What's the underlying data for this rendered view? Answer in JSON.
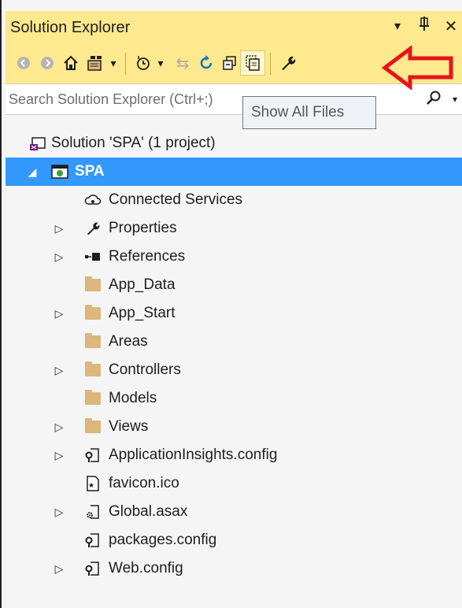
{
  "window": {
    "title": "Solution Explorer",
    "dropdown_glyph": "▾",
    "pin_glyph": "⊥",
    "close_glyph": "✕"
  },
  "toolbar": {
    "back_glyph": "◀",
    "forward_glyph": "▶",
    "home_glyph": "⌂",
    "switch_views_glyph": "⊞",
    "dropdown_glyph": "▾",
    "pending_changes_glyph": "◷",
    "sync_glyph": "⇆",
    "refresh_glyph": "↻",
    "collapse_all_glyph": "⊟",
    "show_all_files_glyph": "❐",
    "properties_glyph": "🔧"
  },
  "search": {
    "placeholder": "Search Solution Explorer (Ctrl+;)",
    "search_glyph": "⚲",
    "dropdown_glyph": "▾"
  },
  "tooltip": {
    "text": "Show All Files"
  },
  "colors": {
    "toolbar_bg": "#ffe98f",
    "selection": "#3399ff",
    "folder": "#dcb67a",
    "annotation_arrow": "#e8131b"
  },
  "tree": {
    "solution": {
      "label": "Solution 'SPA' (1 project)",
      "icon": "solution-icon"
    },
    "project": {
      "label": "SPA",
      "icon": "web-project-icon",
      "expander": "◢"
    },
    "items": [
      {
        "label": "Connected Services",
        "icon": "connected-services-icon",
        "expander": "",
        "glyph": "☁"
      },
      {
        "label": "Properties",
        "icon": "wrench-icon",
        "expander": "▷",
        "glyph": "🔧"
      },
      {
        "label": "References",
        "icon": "references-icon",
        "expander": "▷",
        "glyph": "▪■"
      },
      {
        "label": "App_Data",
        "icon": "folder-icon",
        "expander": ""
      },
      {
        "label": "App_Start",
        "icon": "folder-icon",
        "expander": "▷"
      },
      {
        "label": "Areas",
        "icon": "folder-icon",
        "expander": ""
      },
      {
        "label": "Controllers",
        "icon": "folder-icon",
        "expander": "▷"
      },
      {
        "label": "Models",
        "icon": "folder-icon",
        "expander": ""
      },
      {
        "label": "Views",
        "icon": "folder-icon",
        "expander": "▷"
      },
      {
        "label": "ApplicationInsights.config",
        "icon": "config-file-icon",
        "expander": "▷",
        "glyph": "⚙"
      },
      {
        "label": "favicon.ico",
        "icon": "image-file-icon",
        "expander": "",
        "glyph": "🗋"
      },
      {
        "label": "Global.asax",
        "icon": "asax-file-icon",
        "expander": "▷",
        "glyph": "⚙"
      },
      {
        "label": "packages.config",
        "icon": "config-file-icon",
        "expander": "",
        "glyph": "⚙"
      },
      {
        "label": "Web.config",
        "icon": "config-file-icon",
        "expander": "▷",
        "glyph": "⚙"
      }
    ]
  }
}
